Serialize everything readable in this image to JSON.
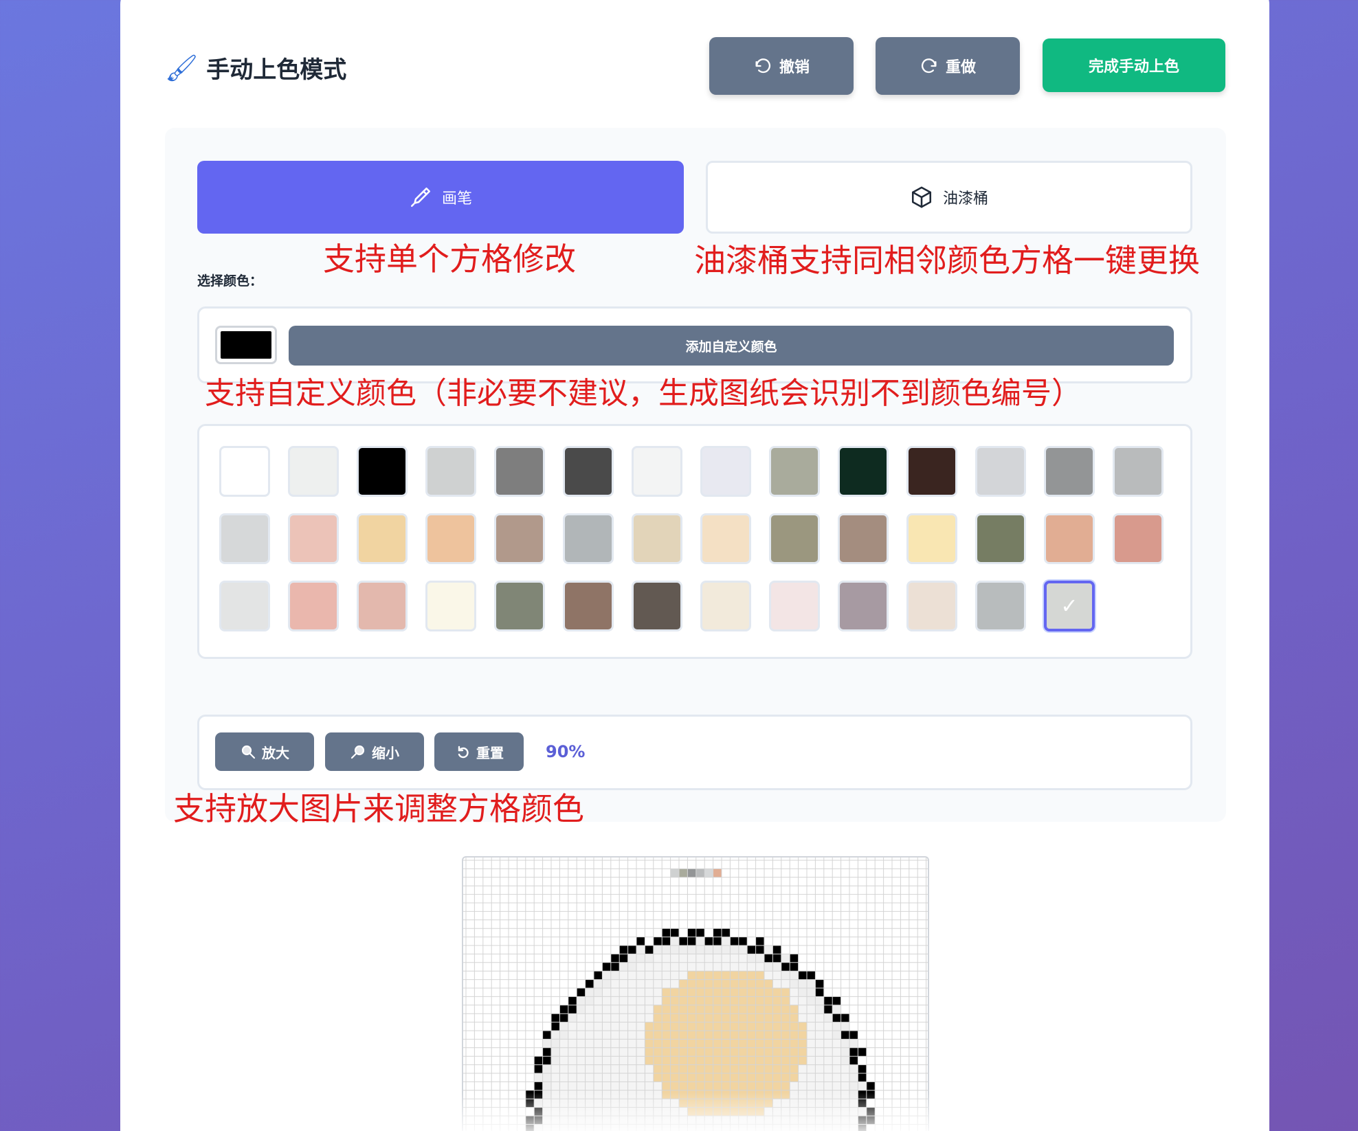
{
  "header": {
    "title": "手动上色模式",
    "title_icon": "paintbrush-icon",
    "undo_label": "撤销",
    "redo_label": "重做",
    "done_label": "完成手动上色"
  },
  "tools": {
    "brush_label": "画笔",
    "bucket_label": "油漆桶",
    "active": "brush"
  },
  "annotations": {
    "brush_note": "支持单个方格修改",
    "bucket_note": "油漆桶支持同相邻颜色方格一键更换",
    "custom_note": "支持自定义颜色（非必要不建议，生成图纸会识别不到颜色编号）",
    "zoom_note": "支持放大图片来调整方格颜色"
  },
  "color_picker": {
    "label": "选择颜色：",
    "current_color": "#000000",
    "add_custom_label": "添加自定义颜色"
  },
  "palette": {
    "selected_index": 40,
    "colors": [
      "#ffffff",
      "#eef0ef",
      "#000000",
      "#cfd1d1",
      "#7e7e7e",
      "#4a4a4a",
      "#f3f4f4",
      "#e8e9f1",
      "#a9ab9c",
      "#0e2b20",
      "#3a2520",
      "#d3d5d8",
      "#939596",
      "#b9bbbc",
      "#d6d8d9",
      "#ecc3b8",
      "#f1d4a1",
      "#eec39d",
      "#b1998b",
      "#b1b6b8",
      "#e2d4b9",
      "#f4e0c4",
      "#9b977f",
      "#a48d7f",
      "#f9e6b2",
      "#767d63",
      "#e1ad93",
      "#d89a8d",
      "#e3e4e4",
      "#eab7ad",
      "#e3b8ad",
      "#faf7e8",
      "#808676",
      "#8f7466",
      "#625952",
      "#f2eadb",
      "#f3e5e5",
      "#a79aa2",
      "#ece0d5",
      "#b8bcbd",
      "#d5d7d4"
    ]
  },
  "zoom": {
    "zoom_in_label": "放大",
    "zoom_out_label": "缩小",
    "reset_label": "重置",
    "level": "90%"
  }
}
